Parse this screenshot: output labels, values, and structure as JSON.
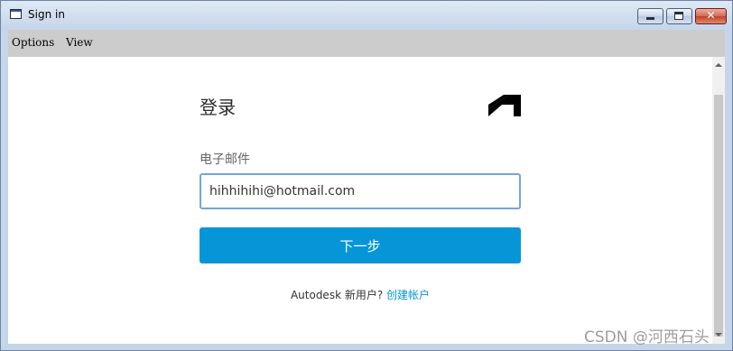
{
  "window": {
    "title": "Sign in",
    "close_glyph": "✕"
  },
  "menubar": {
    "items": [
      {
        "label": "Options"
      },
      {
        "label": "View"
      }
    ]
  },
  "form": {
    "heading": "登录",
    "email_label": "电子邮件",
    "email_value": "hihhihihi@hotmail.com",
    "next_label": "下一步",
    "new_user_text": "Autodesk 新用户?",
    "create_account_link": "创建帐户"
  },
  "watermark": "CSDN @河西石头",
  "icons": {
    "app": "app-window-icon",
    "logo": "autodesk-logo-icon"
  },
  "colors": {
    "primary": "#0696d7",
    "input_border": "#73a5dc"
  }
}
